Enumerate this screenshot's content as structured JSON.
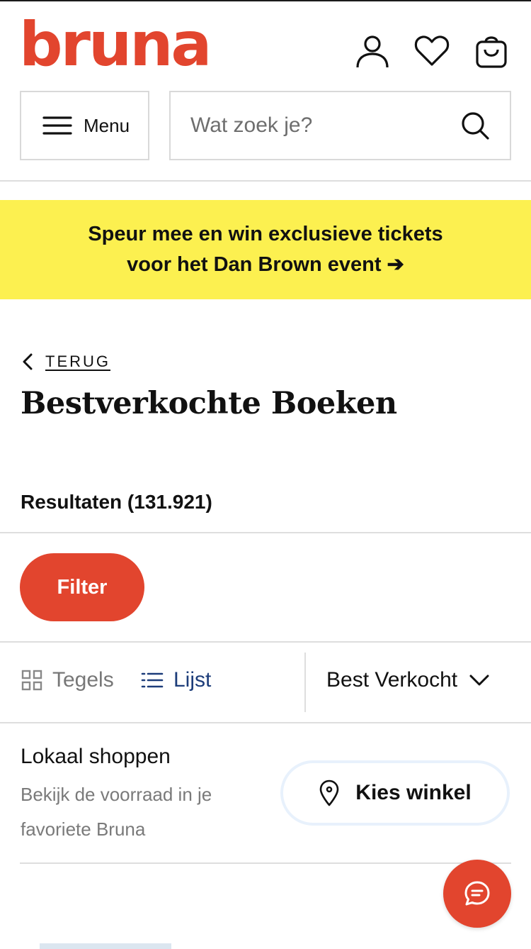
{
  "brand": {
    "logo_text": "bruna",
    "logo_color": "#e2452e"
  },
  "header": {
    "account_icon": "user-icon",
    "wishlist_icon": "heart-icon",
    "cart_icon": "shopping-bag-icon",
    "menu_label": "Menu",
    "search_placeholder": "Wat zoek je?"
  },
  "promo": {
    "line1": "Speur mee en win exclusieve tickets",
    "line2": "voor het Dan Brown event ➔",
    "background": "#fcf050"
  },
  "breadcrumb": {
    "back_label": "TERUG"
  },
  "page": {
    "title": "Bestverkochte Boeken",
    "results": "Resultaten (131.921)"
  },
  "toolbar": {
    "filter_label": "Filter",
    "view_grid_label": "Tegels",
    "view_list_label": "Lijst",
    "active_view": "Lijst",
    "sort_selected": "Best Verkocht"
  },
  "local_shopping": {
    "title": "Lokaal shoppen",
    "subtitle": "Bekijk de voorraad in je favoriete Bruna",
    "button_label": "Kies winkel"
  },
  "chat": {
    "icon": "chat-bubble-icon"
  },
  "colors": {
    "accent": "#e2452e",
    "link_active": "#1d3d7a"
  }
}
